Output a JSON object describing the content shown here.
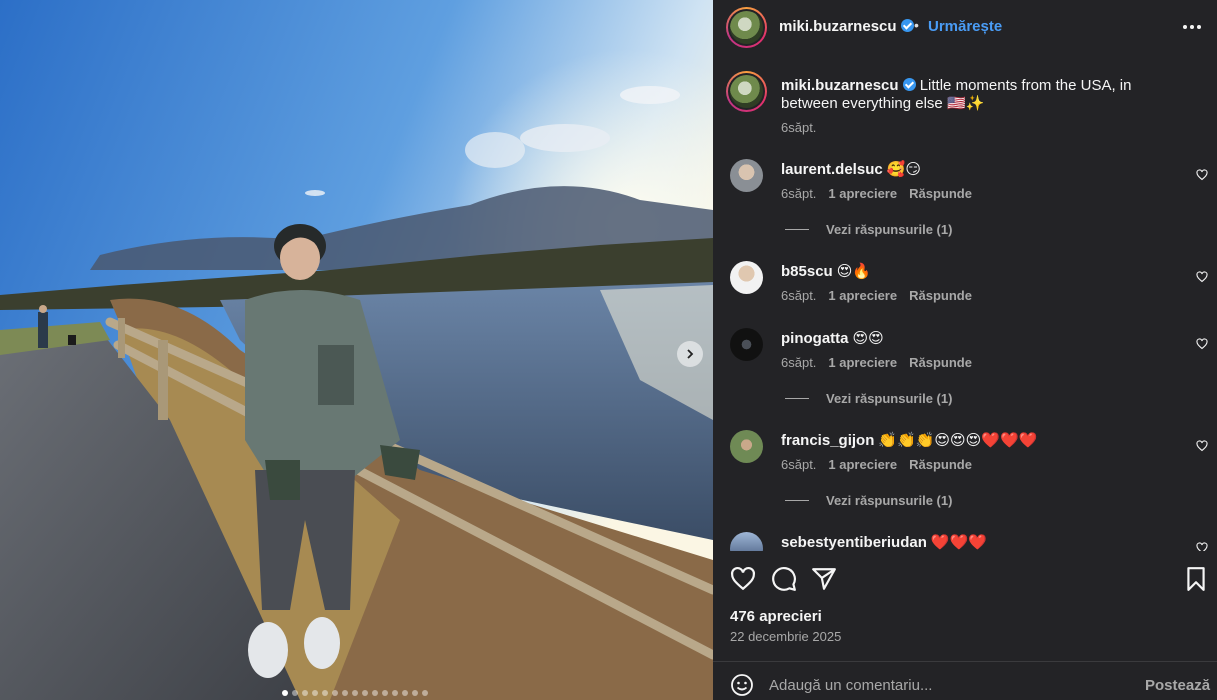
{
  "post": {
    "author": "miki.buzarnescu",
    "follow_label": "Urmărește",
    "separator": "•",
    "more_label": "•••",
    "caption": "Little moments from the USA, in between everything else 🇺🇸✨",
    "caption_time": "6săpt.",
    "carousel": {
      "slides": 15,
      "active": 0
    }
  },
  "comments": [
    {
      "user": "laurent.delsuc",
      "text": "🥰😏",
      "time": "6săpt.",
      "likes": "1 apreciere",
      "reply": "Răspunde",
      "replies_label": "Vezi răspunsurile (1)"
    },
    {
      "user": "b85scu",
      "text": "😍🔥",
      "time": "6săpt.",
      "likes": "1 apreciere",
      "reply": "Răspunde",
      "replies_label": ""
    },
    {
      "user": "pinogatta",
      "text": "😍😍",
      "time": "6săpt.",
      "likes": "1 apreciere",
      "reply": "Răspunde",
      "replies_label": "Vezi răspunsurile (1)"
    },
    {
      "user": "francis_gijon",
      "text": "👏👏👏😍😍😍❤️❤️❤️",
      "time": "6săpt.",
      "likes": "1 apreciere",
      "reply": "Răspunde",
      "replies_label": "Vezi răspunsurile (1)"
    },
    {
      "user": "sebestyentiberiudan",
      "text": "❤️❤️❤️",
      "time": "",
      "likes": "",
      "reply": "",
      "replies_label": ""
    }
  ],
  "footer": {
    "likes_count": "476 aprecieri",
    "date": "22 decembrie 2025",
    "comment_placeholder": "Adaugă un comentariu...",
    "post_label": "Postează"
  },
  "icons": {
    "like": "heart-icon",
    "comment": "comment-icon",
    "share": "send-icon",
    "save": "bookmark-icon",
    "emoji": "emoji-icon",
    "next": "chevron-right-icon"
  },
  "colors": {
    "panel_bg": "#232326",
    "link_blue": "#4a9cf5",
    "muted_text": "#a8a8a8",
    "verified": "#3897f0"
  }
}
